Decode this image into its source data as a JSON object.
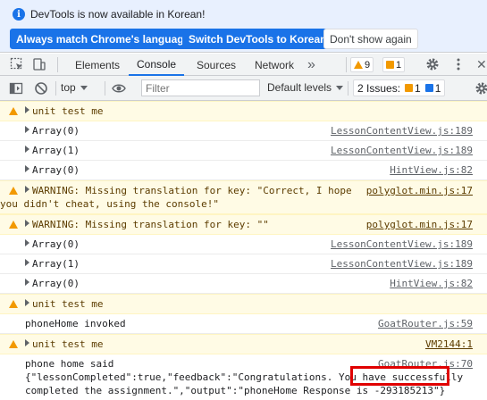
{
  "infobar": {
    "message": "DevTools is now available in Korean!",
    "buttons": [
      "Always match Chrome's language",
      "Switch DevTools to Korean",
      "Don't show again"
    ]
  },
  "tabs": [
    "Elements",
    "Console",
    "Sources",
    "Network"
  ],
  "active_tab": "Console",
  "tab_badges": {
    "warnings": "9",
    "issues": "1"
  },
  "console_toolbar": {
    "context": "top",
    "filter_placeholder": "Filter",
    "levels": "Default levels",
    "issues_label": "2 Issues:",
    "issue_warn_count": "1",
    "issue_info_count": "1"
  },
  "rows": [
    {
      "type": "warn",
      "text": "unit test me",
      "expand": true,
      "src": ""
    },
    {
      "type": "log",
      "text": "Array(0)",
      "expand": true,
      "src": "LessonContentView.js:189"
    },
    {
      "type": "log",
      "text": "Array(1)",
      "expand": true,
      "src": "LessonContentView.js:189"
    },
    {
      "type": "log",
      "text": "Array(0)",
      "expand": true,
      "src": "HintView.js:82"
    },
    {
      "type": "warn",
      "text": "WARNING: Missing translation for key: \"Correct, I hope",
      "text2": "you didn't cheat, using the console!\"",
      "expand": true,
      "src": "polyglot.min.js:17"
    },
    {
      "type": "warn",
      "text": "WARNING: Missing translation for key: \"\"",
      "expand": true,
      "src": "polyglot.min.js:17"
    },
    {
      "type": "log",
      "text": "Array(0)",
      "expand": true,
      "src": "LessonContentView.js:189"
    },
    {
      "type": "log",
      "text": "Array(1)",
      "expand": true,
      "src": "LessonContentView.js:189"
    },
    {
      "type": "log",
      "text": "Array(0)",
      "expand": true,
      "src": "HintView.js:82"
    },
    {
      "type": "warn",
      "text": "unit test me",
      "expand": true,
      "src": ""
    },
    {
      "type": "log",
      "text": "phoneHome invoked",
      "expand": false,
      "src": "GoatRouter.js:59"
    },
    {
      "type": "warn",
      "text": "unit test me",
      "expand": true,
      "src": "VM2144:1"
    },
    {
      "type": "log",
      "text": "phone home said",
      "text2": "{\"lessonCompleted\":true,\"feedback\":\"Congratulations. You have successfully",
      "text3": "completed the assignment.\",\"output\":\"phoneHome Response is -293185213\"}",
      "expand": false,
      "src": "GoatRouter.js:70"
    }
  ]
}
